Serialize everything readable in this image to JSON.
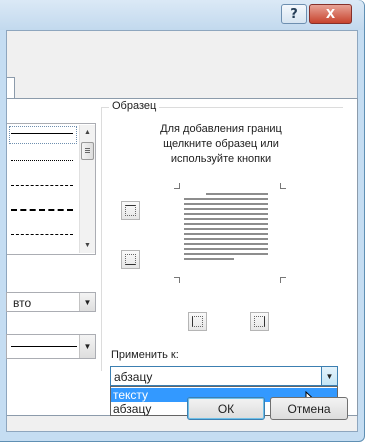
{
  "window": {
    "help_label": "?",
    "close_label": "X"
  },
  "sample_group": {
    "title": "Образец",
    "hint_lines": [
      "Для добавления границ",
      "щелкните образец или",
      "используйте кнопки"
    ]
  },
  "left_panel": {
    "color_combo_value": "вто",
    "width_combo_value": ""
  },
  "apply_to": {
    "label": "Применить к:",
    "selected_value": "абзацу",
    "options": [
      {
        "label": "тексту",
        "highlighted": true
      },
      {
        "label": "абзацу",
        "highlighted": false
      }
    ]
  },
  "buttons": {
    "ok_label": "ОК",
    "cancel_label": "Отмена"
  },
  "colors": {
    "highlight": "#3399ff",
    "title_bar": "#c2d9ee",
    "close_button": "#c7432d"
  }
}
